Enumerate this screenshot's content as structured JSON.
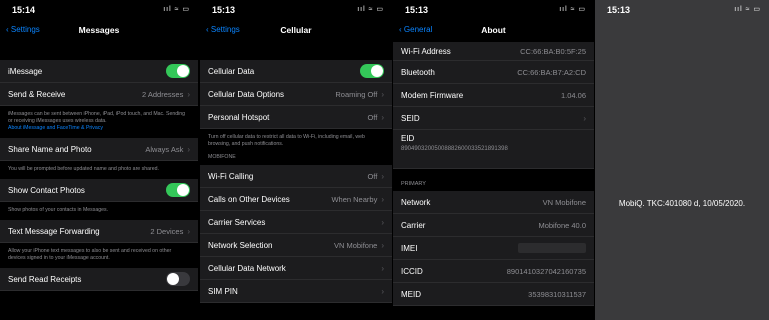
{
  "panel1": {
    "time": "15:14",
    "back": "Settings",
    "title": "Messages",
    "rows": {
      "imessage": "iMessage",
      "send_receive": "Send & Receive",
      "send_receive_value": "2 Addresses",
      "share_name": "Share Name and Photo",
      "share_name_value": "Always Ask",
      "show_contact": "Show Contact Photos",
      "forwarding": "Text Message Forwarding",
      "forwarding_value": "2 Devices",
      "read_receipts": "Send Read Receipts"
    },
    "footers": {
      "imessage_text": "iMessages can be sent between iPhone, iPad, iPod touch, and Mac. Sending or receiving iMessages uses wireless data.",
      "imessage_link": "About iMessage and FaceTime & Privacy",
      "share_name": "You will be prompted before updated name and photo are shared.",
      "show_contact": "Show photos of your contacts in Messages.",
      "forwarding": "Allow your iPhone text messages to also be sent and received on other devices signed in to your iMessage account."
    }
  },
  "panel2": {
    "time": "15:13",
    "back": "Settings",
    "title": "Cellular",
    "rows": {
      "cellular_data": "Cellular Data",
      "data_options": "Cellular Data Options",
      "data_options_value": "Roaming Off",
      "hotspot": "Personal Hotspot",
      "hotspot_value": "Off",
      "wifi_calling": "Wi-Fi Calling",
      "wifi_calling_value": "Off",
      "calls_other": "Calls on Other Devices",
      "calls_other_value": "When Nearby",
      "carrier_services": "Carrier Services",
      "network_selection": "Network Selection",
      "network_selection_value": "VN Mobifone",
      "data_network": "Cellular Data Network",
      "sim_pin": "SIM PIN"
    },
    "footer": "Turn off cellular data to restrict all data to Wi-Fi, including email, web browsing, and push notifications.",
    "section_header": "MOBIFONE"
  },
  "panel3": {
    "time": "15:13",
    "back": "General",
    "title": "About",
    "rows": {
      "wifi_address": "Wi-Fi Address",
      "wifi_address_value": "CC:66:BA:B0:5F:25",
      "bluetooth": "Bluetooth",
      "bluetooth_value": "CC:66:BA:B7:A2:CD",
      "modem": "Modem Firmware",
      "modem_value": "1.04.06",
      "seid": "SEID",
      "eid": "EID",
      "eid_value": "89049032005008882600033521891398",
      "network": "Network",
      "network_value": "VN Mobifone",
      "carrier": "Carrier",
      "carrier_value": "Mobifone 40.0",
      "imei": "IMEI",
      "iccid": "ICCID",
      "iccid_value": "8901410327042160735",
      "meid": "MEID",
      "meid_value": "35398310311537"
    },
    "section_header": "PRIMARY"
  },
  "panel4": {
    "time": "15:13",
    "message": "MobiQ. TKC:401080 d, 10/05/2020."
  },
  "status": {
    "signal": "ııl ≈ ▭"
  }
}
